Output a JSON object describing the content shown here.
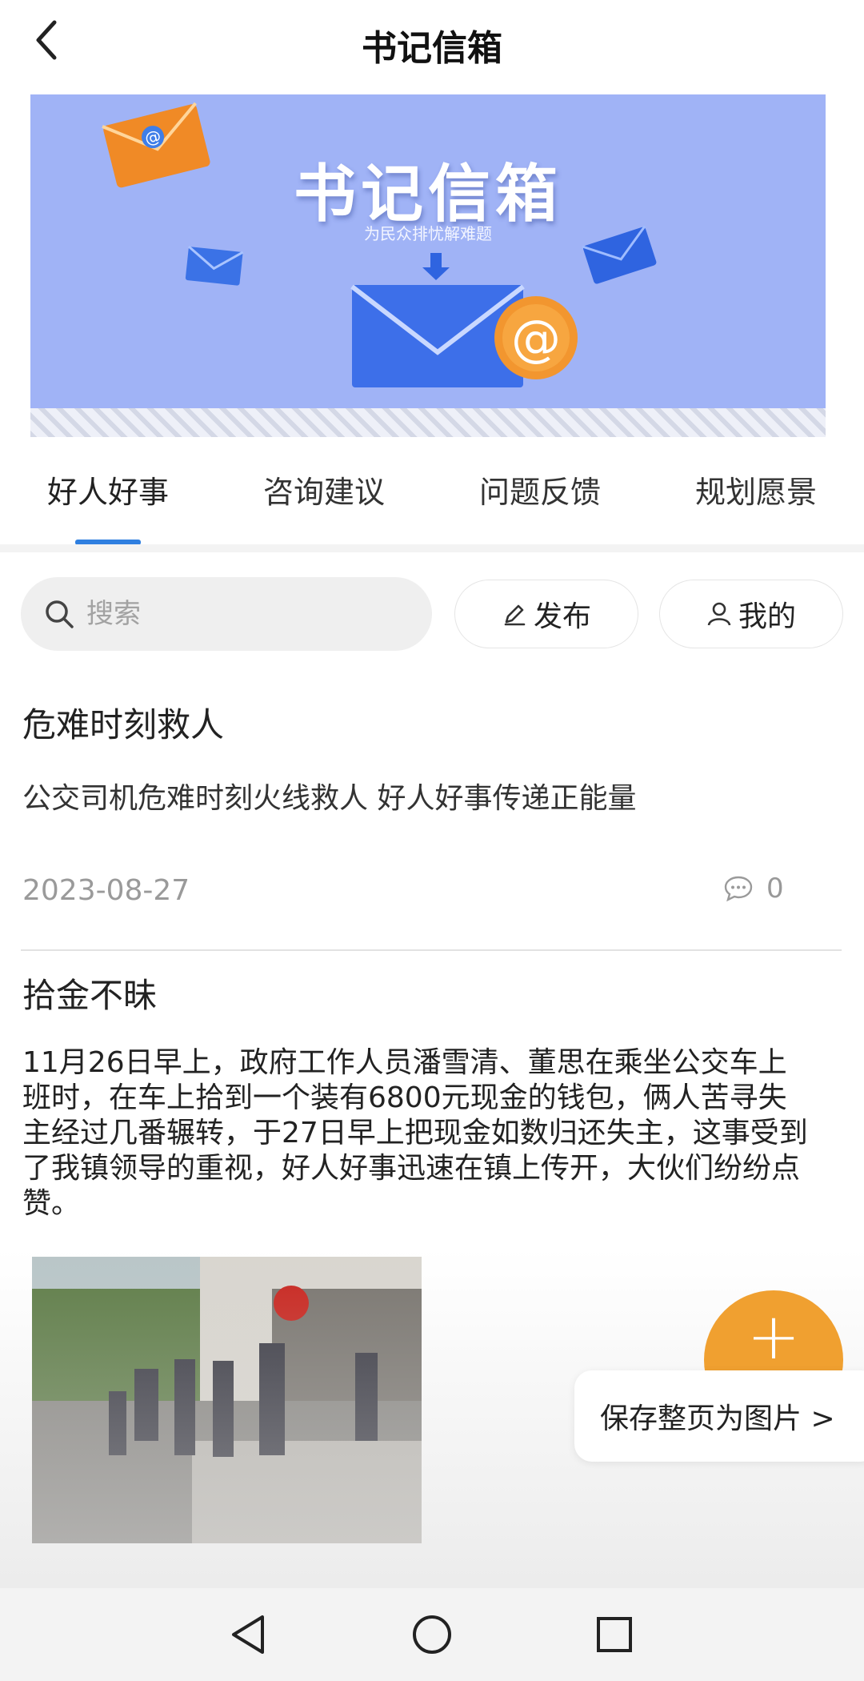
{
  "header": {
    "title": "书记信箱"
  },
  "banner": {
    "title": "书记信箱",
    "subtitle": "为民众排忧解难题"
  },
  "tabs": [
    {
      "label": "好人好事",
      "active": true
    },
    {
      "label": "咨询建议",
      "active": false
    },
    {
      "label": "问题反馈",
      "active": false
    },
    {
      "label": "规划愿景",
      "active": false
    }
  ],
  "toolbar": {
    "search_placeholder": "搜索",
    "publish_label": "发布",
    "mine_label": "我的"
  },
  "posts": [
    {
      "title": "危难时刻救人",
      "summary": "公交司机危难时刻火线救人 好人好事传递正能量",
      "date": "2023-08-27",
      "comments": "0"
    },
    {
      "title": "拾金不昧",
      "body_lines": [
        "11月26日早上，政府工作人员潘雪清、董思在乘坐公交车上",
        "班时，在车上拾到一个装有6800元现金的钱包，俩人苦寻失",
        "主经过几番辗转，于27日早上把现金如数归还失主，这事受到",
        "了我镇领导的重视，好人好事迅速在镇上传开，大伙们纷纷点",
        "赞。"
      ]
    }
  ],
  "fab": {
    "label": "发布"
  },
  "save_page": {
    "label": "保存整页为图片 >"
  },
  "colors": {
    "accent": "#2f7fe0",
    "fab": "#f0a030",
    "banner": "#a0b3f6"
  },
  "icons": [
    "back-icon",
    "search-icon",
    "edit-icon",
    "user-icon",
    "comment-icon",
    "plus-icon",
    "nav-back-icon",
    "nav-home-icon",
    "nav-recents-icon"
  ]
}
